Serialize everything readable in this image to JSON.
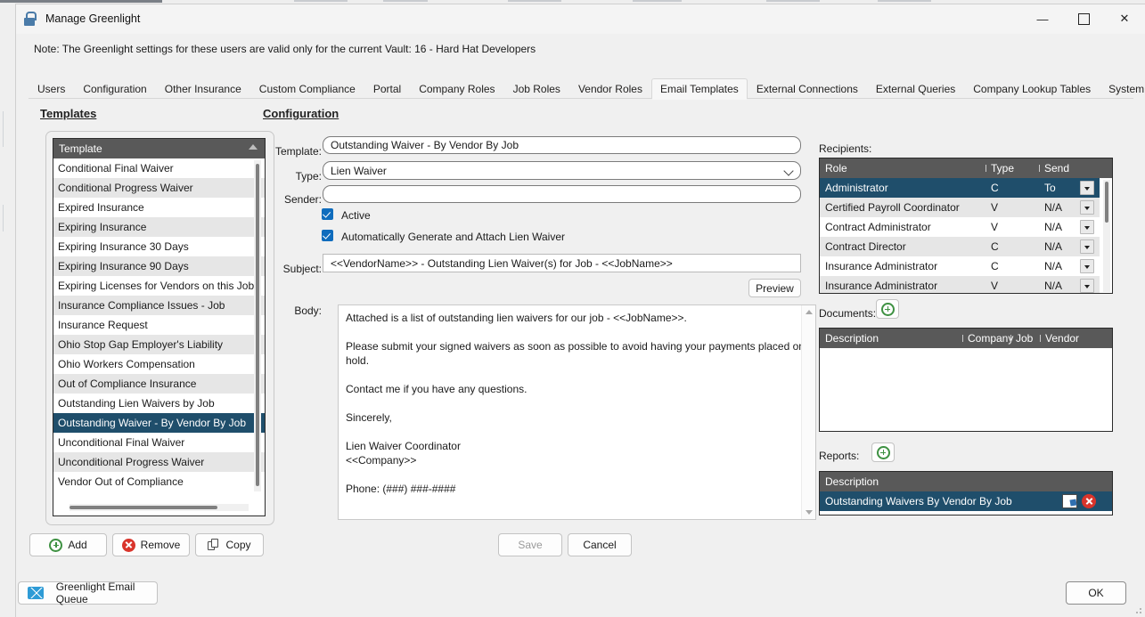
{
  "window": {
    "title": "Manage Greenlight",
    "icon": "lock-icon",
    "minimize": "—",
    "maximize": "☐",
    "close": "✕"
  },
  "note": "Note:  The Greenlight settings for these users are valid only for the current Vault: 16 - Hard Hat Developers",
  "tabs": [
    {
      "label": "Users",
      "active": false
    },
    {
      "label": "Configuration",
      "active": false
    },
    {
      "label": "Other Insurance",
      "active": false
    },
    {
      "label": "Custom Compliance",
      "active": false
    },
    {
      "label": "Portal",
      "active": false
    },
    {
      "label": "Company Roles",
      "active": false
    },
    {
      "label": "Job Roles",
      "active": false
    },
    {
      "label": "Vendor Roles",
      "active": false
    },
    {
      "label": "Email Templates",
      "active": true
    },
    {
      "label": "External Connections",
      "active": false
    },
    {
      "label": "External Queries",
      "active": false
    },
    {
      "label": "Company Lookup Tables",
      "active": false
    },
    {
      "label": "System Lookup Tables",
      "active": false
    }
  ],
  "templates_section": {
    "heading": "Templates",
    "column_header": "Template",
    "sort_indicator": "sort-ascending",
    "rows": [
      "Conditional Final Waiver",
      "Conditional Progress Waiver",
      "Expired Insurance",
      "Expiring Insurance",
      "Expiring Insurance 30 Days",
      "Expiring Insurance 90 Days",
      "Expiring Licenses for Vendors on this Job",
      "Insurance Compliance Issues - Job",
      "Insurance Request",
      "Ohio Stop Gap Employer's Liability",
      "Ohio Workers Compensation",
      "Out of Compliance Insurance",
      "Outstanding Lien Waivers by Job",
      "Outstanding Waiver - By Vendor By Job",
      "Unconditional Final Waiver",
      "Unconditional Progress Waiver",
      "Vendor Out of Compliance"
    ],
    "selected_index": 13,
    "buttons": {
      "add": "Add",
      "remove": "Remove",
      "copy": "Copy"
    }
  },
  "configuration": {
    "heading": "Configuration",
    "labels": {
      "template": "Template:",
      "type": "Type:",
      "sender": "Sender:",
      "subject": "Subject:",
      "body": "Body:"
    },
    "template_value": "Outstanding Waiver - By Vendor By Job",
    "type_value": "Lien Waiver",
    "sender_value": "",
    "checkboxes": [
      {
        "label": "Active",
        "checked": true
      },
      {
        "label": "Automatically Generate and Attach Lien Waiver",
        "checked": true
      }
    ],
    "subject_value": "<<VendorName>> - Outstanding Lien Waiver(s) for Job - <<JobName>>",
    "preview_button": "Preview",
    "body_value": "Attached is a list of outstanding lien waivers for our job - <<JobName>>.\n\nPlease submit your signed waivers as soon as possible to avoid having your payments placed on hold.\n\nContact me if you have any questions.\n\nSincerely,\n\nLien Waiver Coordinator\n<<Company>>\n\nPhone: (###) ###-####",
    "save_button": "Save",
    "cancel_button": "Cancel"
  },
  "recipients": {
    "label": "Recipients:",
    "columns": [
      "Role",
      "Type",
      "Send"
    ],
    "rows": [
      {
        "role": "Administrator",
        "type": "C",
        "send": "To"
      },
      {
        "role": "Certified Payroll Coordinator",
        "type": "V",
        "send": "N/A"
      },
      {
        "role": "Contract Administrator",
        "type": "V",
        "send": "N/A"
      },
      {
        "role": "Contract Director",
        "type": "C",
        "send": "N/A"
      },
      {
        "role": "Insurance Administrator",
        "type": "C",
        "send": "N/A"
      },
      {
        "role": "Insurance Administrator",
        "type": "V",
        "send": "N/A"
      }
    ],
    "selected_index": 0
  },
  "documents": {
    "label": "Documents:",
    "add_icon": "plus-circle-icon",
    "columns": [
      "Description",
      "Company",
      "Job",
      "Vendor",
      ""
    ],
    "rows": []
  },
  "reports": {
    "label": "Reports:",
    "add_icon": "plus-circle-icon",
    "columns": [
      "Description",
      "",
      ""
    ],
    "rows": [
      {
        "description": "Outstanding Waivers By Vendor By Job",
        "edit_icon": "edit-icon",
        "delete_icon": "delete-circle-icon"
      }
    ],
    "selected_index": 0
  },
  "footer": {
    "email_queue_button": "Greenlight Email Queue",
    "email_queue_icon": "mail-icon",
    "ok_button": "OK"
  },
  "colors": {
    "selection": "#1f4e6b",
    "grid_header": "#595959",
    "checkbox": "#0f6cbd",
    "add_green": "#3e9142",
    "delete_red": "#d9342b",
    "mail_blue": "#2e9bd6"
  }
}
